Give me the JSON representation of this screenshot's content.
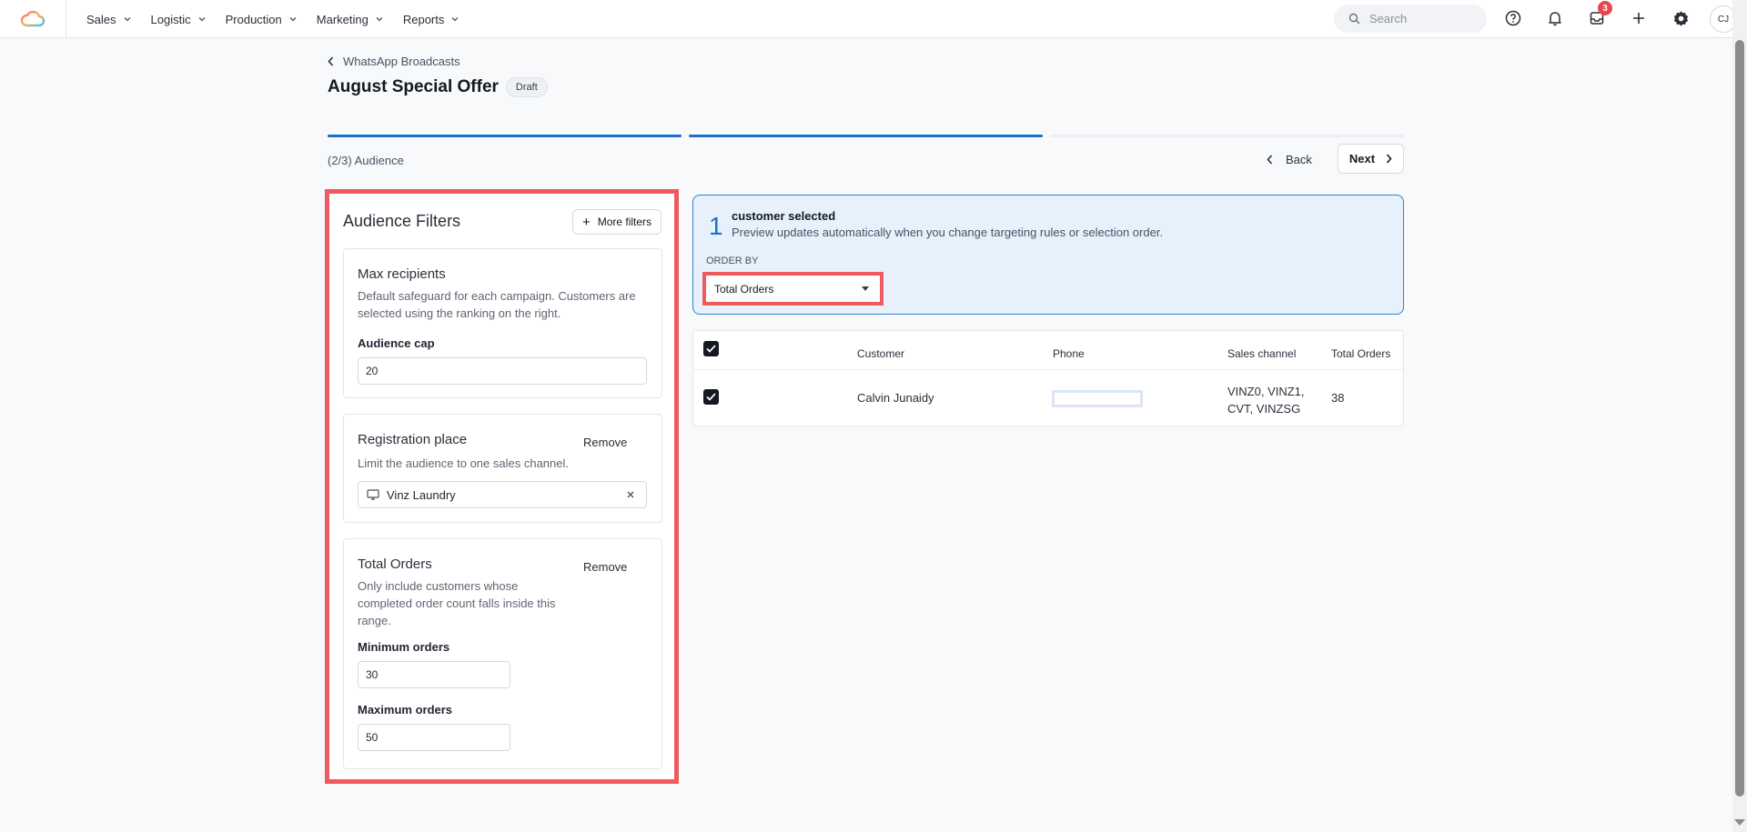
{
  "topbar": {
    "nav": [
      {
        "label": "Sales"
      },
      {
        "label": "Logistic"
      },
      {
        "label": "Production"
      },
      {
        "label": "Marketing"
      },
      {
        "label": "Reports"
      }
    ],
    "search_placeholder": "Search",
    "inbox_badge": "3",
    "avatar_initials": "CJ",
    "icons": [
      "help-icon",
      "bell-icon",
      "inbox-icon",
      "plus-icon",
      "gear-icon"
    ]
  },
  "header": {
    "breadcrumb": "WhatsApp Broadcasts",
    "title": "August Special Offer",
    "status_badge": "Draft",
    "step_label": "(2/3) Audience",
    "back_label": "Back",
    "next_label": "Next",
    "steps_total": 3,
    "steps_complete": 2
  },
  "filters": {
    "title": "Audience Filters",
    "more_filters_label": "More filters",
    "max_recipients": {
      "title": "Max recipients",
      "description": "Default safeguard for each campaign. Customers are selected using the ranking on the right.",
      "field_label": "Audience cap",
      "value": "20"
    },
    "registration_place": {
      "title": "Registration place",
      "remove_label": "Remove",
      "description": "Limit the audience to one sales channel.",
      "selected": "Vinz Laundry"
    },
    "total_orders": {
      "title": "Total Orders",
      "remove_label": "Remove",
      "description": "Only include customers whose completed order count falls inside this range.",
      "min_label": "Minimum orders",
      "min_value": "30",
      "max_label": "Maximum orders",
      "max_value": "50"
    }
  },
  "summary": {
    "count": "1",
    "title": "customer selected",
    "description": "Preview updates automatically when you change targeting rules or selection order.",
    "order_by_label": "ORDER BY",
    "order_by_value": "Total Orders"
  },
  "table": {
    "columns": [
      "Customer",
      "Phone",
      "Sales channel",
      "Total Orders"
    ],
    "rows": [
      {
        "customer": "Calvin Junaidy",
        "phone": "",
        "sales_channel_line1": "VINZ0, VINZ1,",
        "sales_channel_line2": "CVT, VINZSG",
        "total_orders": "38"
      }
    ]
  },
  "colors": {
    "accent": "#1a6fce",
    "highlight": "#ef5a5f",
    "summary_bg": "#e7f1fc",
    "badge": "#e5484d"
  }
}
